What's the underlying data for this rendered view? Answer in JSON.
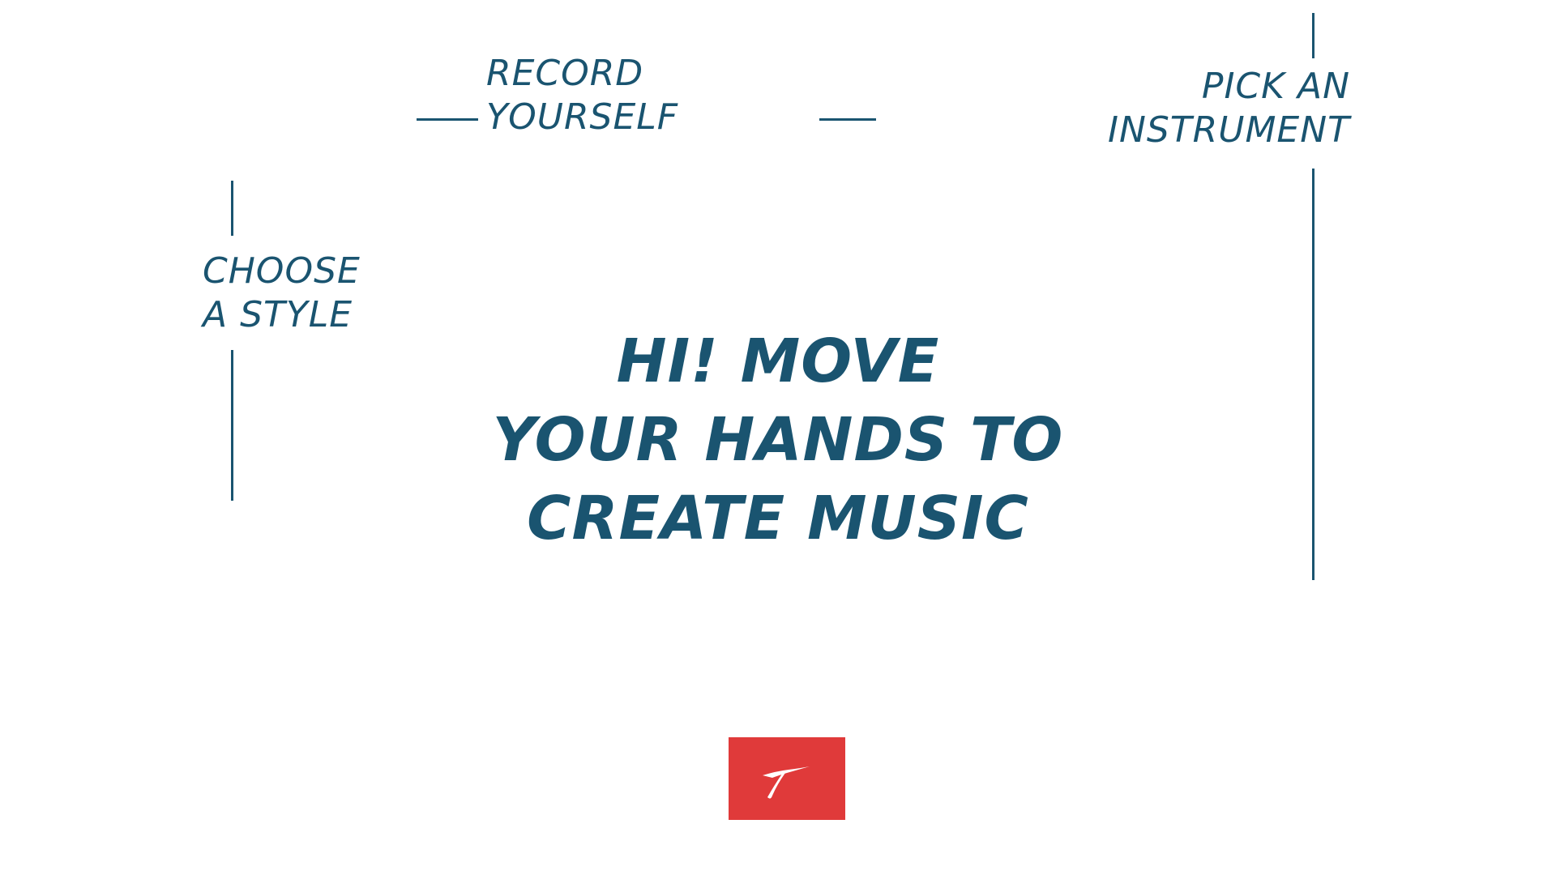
{
  "zones": {
    "record": {
      "lines": [
        "RECORD",
        "YOURSELF"
      ]
    },
    "instrument": {
      "lines": [
        "PICK AN",
        "INSTRUMENT"
      ]
    },
    "style": {
      "lines": [
        "CHOOSE",
        "A STYLE"
      ]
    }
  },
  "welcome": {
    "lines": [
      "HI! MOVE",
      "YOUR HANDS TO",
      "CREATE MUSIC"
    ]
  },
  "colors": {
    "text": "#1a5470",
    "background": "#ffffff",
    "brand": "#e03a3a"
  },
  "icons": {
    "logo": "brand-logo-icon"
  }
}
